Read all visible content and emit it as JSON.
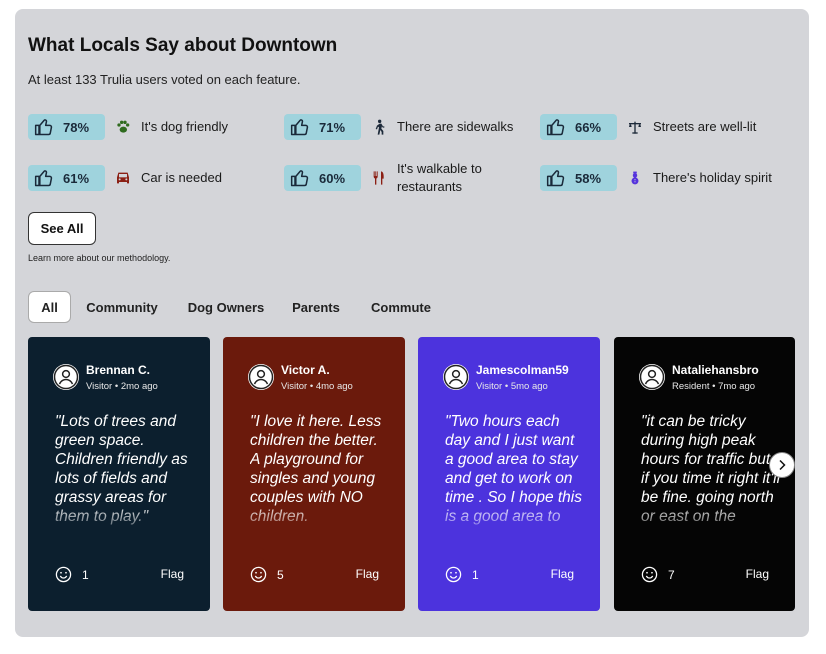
{
  "header": {
    "title": "What Locals Say about Downtown",
    "subtitle": "At least 133 Trulia users voted on each feature."
  },
  "features": [
    {
      "percent": "78%",
      "label": "It's dog friendly",
      "icon": "paw-icon",
      "color": "#2f6b1f"
    },
    {
      "percent": "71%",
      "label": "There are sidewalks",
      "icon": "walking-person-icon",
      "color": "#1d2a3a"
    },
    {
      "percent": "66%",
      "label": "Streets are well-lit",
      "icon": "street-lamp-icon",
      "color": "#1d2a3a"
    },
    {
      "percent": "61%",
      "label": "Car is needed",
      "icon": "car-icon",
      "color": "#8b1f14"
    },
    {
      "percent": "60%",
      "label": "It's walkable to restaurants",
      "icon": "fork-knife-icon",
      "color": "#8b1f14"
    },
    {
      "percent": "58%",
      "label": "There's holiday spirit",
      "icon": "snowman-icon",
      "color": "#5533dd"
    }
  ],
  "see_all": "See All",
  "methodology": "Learn more about our methodology.",
  "tabs": [
    "All",
    "Community",
    "Dog Owners",
    "Parents",
    "Commute"
  ],
  "active_tab": "All",
  "cards": [
    {
      "name": "Brennan C.",
      "meta": "Visitor • 2mo ago",
      "quote": "\"Lots of trees and green space. Children friendly as lots of fields and grassy areas for them to play.\"",
      "reactions": "1",
      "flag": "Flag",
      "bg": "#0c1f2e"
    },
    {
      "name": "Victor A.",
      "meta": "Visitor • 4mo ago",
      "quote": "\"I love it here. Less children the better. A playground for singles and young couples with NO children.",
      "reactions": "5",
      "flag": "Flag",
      "bg": "#6b1a0c"
    },
    {
      "name": "Jamescolman59",
      "meta": "Visitor • 5mo ago",
      "quote": "\"Two hours each day and I just want a good area to stay and get to work on time . So I hope this is a good area to",
      "reactions": "1",
      "flag": "Flag",
      "bg": "#4c33dd"
    },
    {
      "name": "Nataliehansbro",
      "meta": "Resident • 7mo ago",
      "quote": "\"it can be tricky during high peak hours for traffic but if you time it right it'll be fine. going north or east on the",
      "reactions": "7",
      "flag": "Flag",
      "bg": "#050505"
    }
  ],
  "colors": {
    "panel": "#d4d5d9",
    "badge": "#9fd3dd"
  }
}
